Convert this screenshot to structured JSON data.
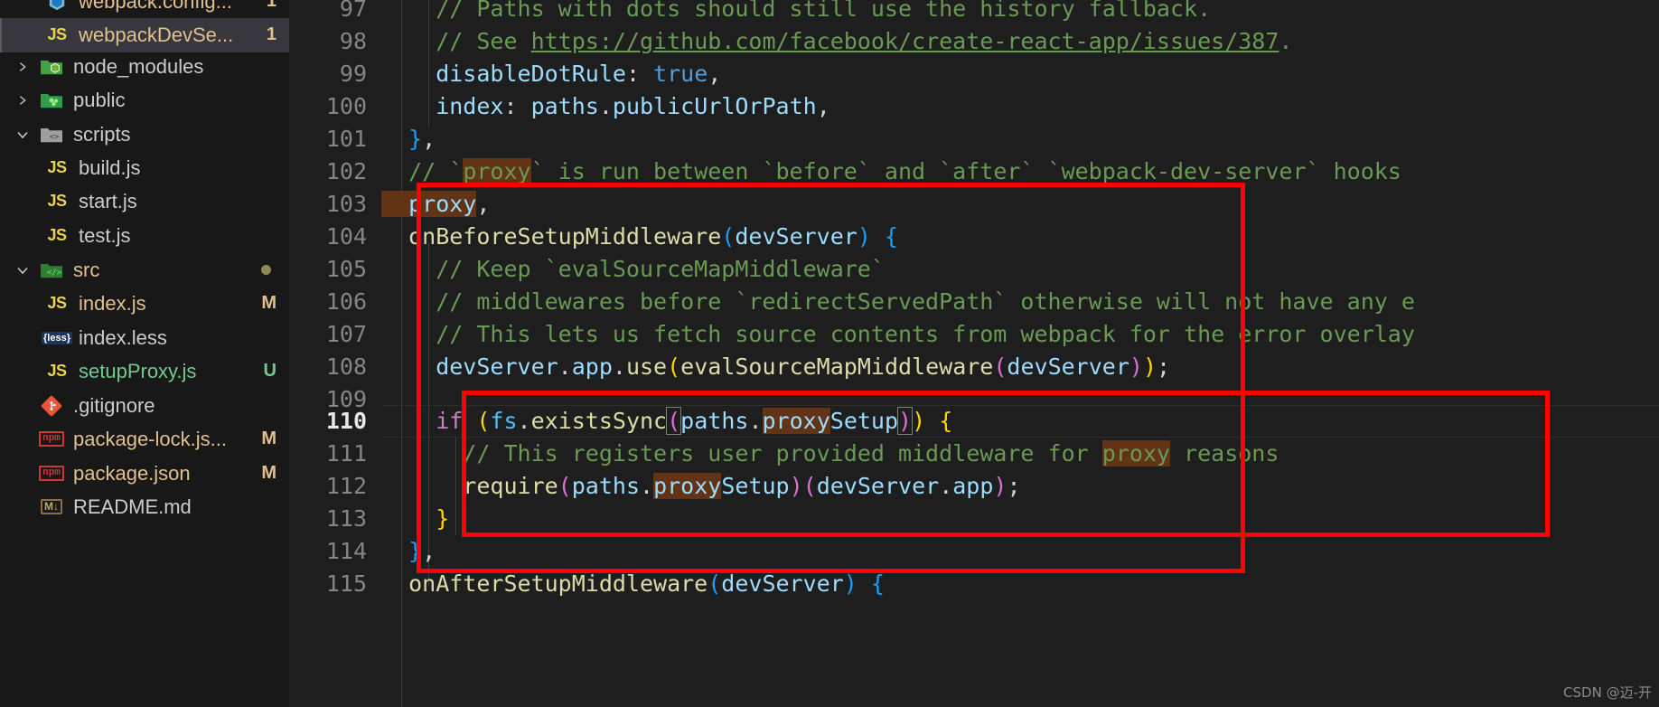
{
  "sidebar": {
    "items": [
      {
        "label": "webpack.config...",
        "icon": "webpack-icon",
        "indent": 0,
        "type": "file",
        "selected": false,
        "badge": "1",
        "badge_color": "#e2c08d",
        "clipped_top": true
      },
      {
        "label": "webpackDevSe...",
        "icon": "js-icon",
        "indent": 0,
        "type": "file",
        "selected": true,
        "badge": "1",
        "badge_color": "#e2c08d"
      },
      {
        "label": "node_modules",
        "icon": "folder-node-icon",
        "indent": 0,
        "type": "folder",
        "expanded": false,
        "selected": false
      },
      {
        "label": "public",
        "icon": "folder-public-icon",
        "indent": 0,
        "type": "folder",
        "expanded": false,
        "selected": false
      },
      {
        "label": "scripts",
        "icon": "folder-scripts-icon",
        "indent": 0,
        "type": "folder",
        "expanded": true,
        "selected": false
      },
      {
        "label": "build.js",
        "icon": "js-icon",
        "indent": 1,
        "type": "file",
        "selected": false
      },
      {
        "label": "start.js",
        "icon": "js-icon",
        "indent": 1,
        "type": "file",
        "selected": false
      },
      {
        "label": "test.js",
        "icon": "js-icon",
        "indent": 1,
        "type": "file",
        "selected": false
      },
      {
        "label": "src",
        "icon": "folder-src-icon",
        "indent": 0,
        "type": "folder",
        "expanded": true,
        "selected": false,
        "modified_dot": true
      },
      {
        "label": "index.js",
        "icon": "js-icon",
        "indent": 1,
        "type": "file",
        "selected": false,
        "badge": "M",
        "badge_color": "#e2c08d",
        "label_color": "#e2c08d"
      },
      {
        "label": "index.less",
        "icon": "less-icon",
        "indent": 1,
        "type": "file",
        "selected": false
      },
      {
        "label": "setupProxy.js",
        "icon": "js-icon",
        "indent": 1,
        "type": "file",
        "selected": false,
        "badge": "U",
        "badge_color": "#73c991",
        "label_color": "#73c991"
      },
      {
        "label": ".gitignore",
        "icon": "git-icon",
        "indent": 0,
        "type": "file",
        "selected": false
      },
      {
        "label": "package-lock.js...",
        "icon": "npm-icon",
        "indent": 0,
        "type": "file",
        "selected": false,
        "badge": "M",
        "badge_color": "#e2c08d",
        "label_color": "#e2c08d"
      },
      {
        "label": "package.json",
        "icon": "npm-icon",
        "indent": 0,
        "type": "file",
        "selected": false,
        "badge": "M",
        "badge_color": "#e2c08d",
        "label_color": "#e2c08d"
      },
      {
        "label": "README.md",
        "icon": "markdown-icon",
        "indent": 0,
        "type": "file",
        "selected": false
      }
    ]
  },
  "editor": {
    "active_line": 110,
    "first_line": 97,
    "line_numbers": [
      97,
      98,
      99,
      100,
      101,
      102,
      103,
      104,
      105,
      106,
      107,
      108,
      109,
      110,
      111,
      112,
      113,
      114,
      115
    ],
    "lines": [
      {
        "n": 97,
        "text": "    // Paths with dots should still use the history fallback."
      },
      {
        "n": 98,
        "text": "    // See https://github.com/facebook/create-react-app/issues/387."
      },
      {
        "n": 99,
        "text": "    disableDotRule: true,"
      },
      {
        "n": 100,
        "text": "    index: paths.publicUrlOrPath,"
      },
      {
        "n": 101,
        "text": "  },"
      },
      {
        "n": 102,
        "text": "  // `proxy` is run between `before` and `after` `webpack-dev-server` hooks"
      },
      {
        "n": 103,
        "text": "  proxy,"
      },
      {
        "n": 104,
        "text": "  onBeforeSetupMiddleware(devServer) {"
      },
      {
        "n": 105,
        "text": "    // Keep `evalSourceMapMiddleware`"
      },
      {
        "n": 106,
        "text": "    // middlewares before `redirectServedPath` otherwise will not have any e"
      },
      {
        "n": 107,
        "text": "    // This lets us fetch source contents from webpack for the error overlay"
      },
      {
        "n": 108,
        "text": "    devServer.app.use(evalSourceMapMiddleware(devServer));"
      },
      {
        "n": 109,
        "text": ""
      },
      {
        "n": 110,
        "text": "    if (fs.existsSync(paths.proxySetup)) {"
      },
      {
        "n": 111,
        "text": "      // This registers user provided middleware for proxy reasons"
      },
      {
        "n": 112,
        "text": "      require(paths.proxySetup)(devServer.app);"
      },
      {
        "n": 113,
        "text": "    }"
      },
      {
        "n": 114,
        "text": "  },"
      },
      {
        "n": 115,
        "text": "  onAfterSetupMiddleware(devServer) {"
      }
    ],
    "highlighted_word": "proxy",
    "annotations": [
      {
        "name": "outer-highlight-box",
        "color": "#FF0000"
      },
      {
        "name": "inner-highlight-box",
        "color": "#FF0000"
      }
    ]
  },
  "watermark": {
    "text": "CSDN @迈-开"
  }
}
